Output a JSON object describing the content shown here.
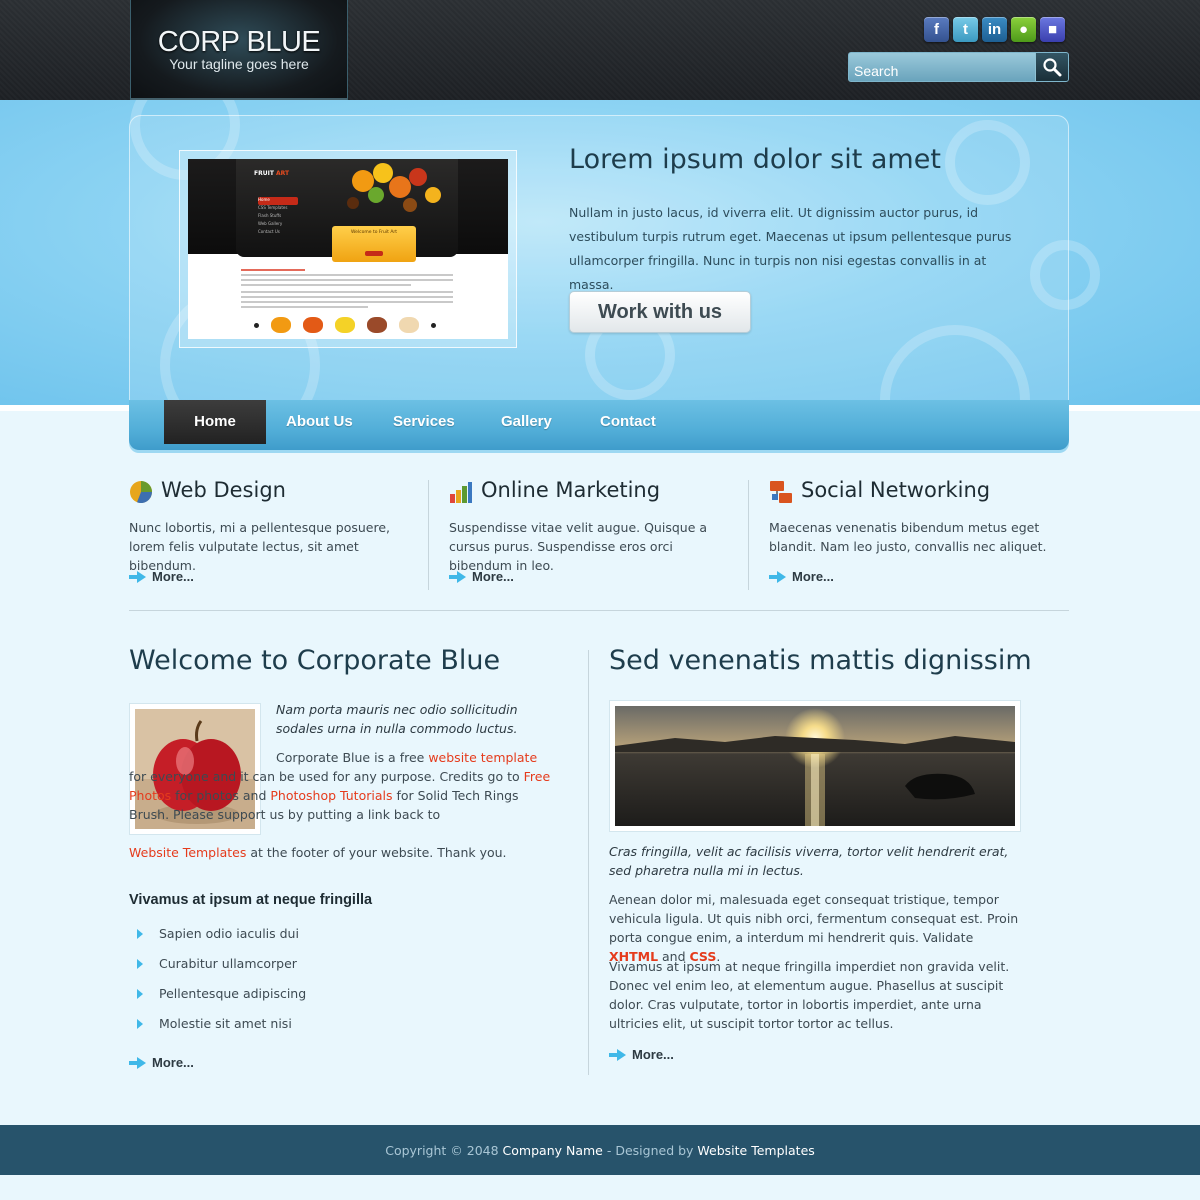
{
  "header": {
    "logo_title": "CORP BLUE",
    "logo_tagline": "Your tagline goes here",
    "social_icons": [
      "facebook-icon",
      "twitter-icon",
      "linkedin-icon",
      "chat-icon",
      "messenger-icon"
    ],
    "search_placeholder": "Search"
  },
  "hero": {
    "title": "Lorem ipsum dolor sit amet",
    "text": "Nullam in justo lacus, id viverra elit. Ut dignissim auctor purus, id vestibulum turpis rutrum eget. Maecenas ut ipsum pellentesque purus ullamcorper fringilla. Nunc in turpis non nisi egestas convallis in at massa.",
    "button": "Work with us",
    "screenshot": {
      "brand_a": "FRUIT",
      "brand_b": "ART",
      "menu": [
        "Home",
        "CSS Templates",
        "Flash Stuffs",
        "Web Gallery",
        "Contact Us"
      ],
      "welcome": "Welcome to Fruit Art"
    }
  },
  "nav": {
    "items": [
      "Home",
      "About Us",
      "Services",
      "Gallery",
      "Contact"
    ],
    "active": "Home"
  },
  "features": [
    {
      "title": "Web Design",
      "icon": "pie-chart-icon",
      "text": "Nunc lobortis, mi a pellentesque posuere, lorem felis vulputate lectus, sit amet bibendum.",
      "more": "More..."
    },
    {
      "title": "Online Marketing",
      "icon": "bar-chart-icon",
      "text": "Suspendisse vitae velit augue. Quisque a cursus purus. Suspendisse eros orci bibendum in leo.",
      "more": "More..."
    },
    {
      "title": "Social Networking",
      "icon": "network-icon",
      "text": "Maecenas venenatis bibendum metus eget blandit. Nam leo justo, convallis nec aliquet.",
      "more": "More..."
    }
  ],
  "welcome": {
    "title": "Welcome to Corporate Blue",
    "intro": "Nam porta mauris nec odio sollicitudin sodales urna in nulla commodo luctus.",
    "p1": "Corporate Blue is a free",
    "link1": "website template",
    "p2": "for everyone and it can be used for any purpose. Credits go to",
    "link2": "Free Photos",
    "p3": "for photos and",
    "link3": "Photoshop Tutorials",
    "p4": "for Solid Tech Rings Brush. Please support us by putting a link back to",
    "link4": "Website Templates",
    "p5": "at the footer of your website. Thank you.",
    "subheading": "Vivamus at ipsum at neque fringilla",
    "list": [
      "Sapien odio iaculis dui",
      "Curabitur ullamcorper",
      "Pellentesque adipiscing",
      "Molestie sit amet nisi"
    ],
    "more": "More..."
  },
  "sed": {
    "title": "Sed venenatis mattis dignissim",
    "caption": "Cras fringilla, velit ac facilisis viverra, tortor velit hendrerit erat, sed pharetra nulla mi in lectus.",
    "p1": "Aenean dolor mi, malesuada eget consequat tristique, tempor vehicula ligula. Ut quis nibh orci, fermentum consequat est. Proin porta congue enim, a interdum mi hendrerit quis. Validate",
    "xhtml": "XHTML",
    "and": "and",
    "css": "CSS",
    "p2": "Vivamus at ipsum at neque fringilla imperdiet non gravida velit. Donec vel enim leo, at elementum augue. Phasellus at suscipit dolor. Cras vulputate, tortor in lobortis imperdiet, ante urna ultricies elit, ut suscipit tortor tortor ac tellus.",
    "more": "More..."
  },
  "footer": {
    "copyright": "Copyright © 2048",
    "company": "Company Name",
    "designed_by": "- Designed by",
    "templates": "Website Templates"
  },
  "colors": {
    "accent": "#3fb8e8",
    "link": "#e53b1c",
    "footer": "#27536b",
    "heading": "#1e3d4c"
  }
}
